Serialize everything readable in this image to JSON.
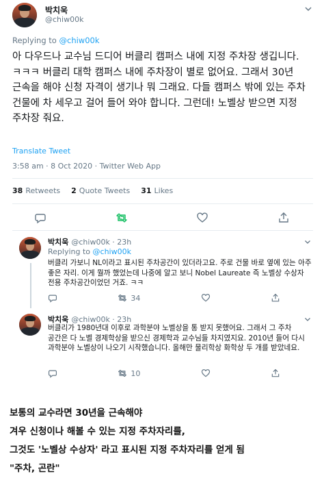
{
  "main_tweet": {
    "name": "박치욱",
    "handle": "@chiw00k",
    "replying_label": "Replying to",
    "replying_handle": "@chiw00k",
    "text": "아 다우드나 교수님 드디어 버클리 캠퍼스 내에 지정 주차장 생깁니다. ㅋㅋㅋ 버클리 대학 캠퍼스 내에 주차장이 별로 없어요. 그래서 30년 근속을 해야 신청 자격이 생기나 뭐 그래요. 다들 캠퍼스 밖에 있는 주차 건물에 차 세우고 걸어 들어 와야 합니다. 그런데! 노벨상 받으면 지정 주차장 줘요.",
    "translate_label": "Translate Tweet",
    "meta": "3:58 am · 8 Oct 2020 · Twitter Web App",
    "retweets_count": "38",
    "retweets_label": "Retweets",
    "quotes_count": "2",
    "quotes_label": "Quote Tweets",
    "likes_count": "31",
    "likes_label": "Likes"
  },
  "replies": [
    {
      "name": "박치욱",
      "handle": "@chiw00k · 23h",
      "replying_label": "Replying to",
      "replying_handle": "@chiw00k",
      "text": "버클리 가보니 NL이라고 표시된 주차공간이 있더라고요. 주로 건물 바로 옆에 있는 아주 좋은 자리. 이게 뭘까 했었는데 나중에 알고 보니 Nobel Laureate 즉 노벨상 수상자 전용 주차공간이었던 거죠. ㅋㅋ",
      "retweets": "34"
    },
    {
      "name": "박치욱",
      "handle": "@chiw00k · 23h",
      "text": "버클리가 1980년대 이후로 과학분야 노벨상을 통 받지 못했어요. 그래서 그 주차 공간은 다 노벨 경제학상을 받으신 경제학과 교수님들 차지였지요. 2010년 들어 다시 과학분야 노벨상이 나오기 시작했습니다. 올해만 물리학상 화학상 두 개를 받았네요.",
      "retweets": "10"
    }
  ],
  "caption": {
    "line1": "보통의 교수라면 30년을 근속해야",
    "line2": "겨우 신청이나 해볼 수 있는 지정 주차자리를,",
    "line3": "그것도 '노벨상 수상자' 라고 표시된 지정 주차자리를 얻게 됨",
    "line4": "\"주차, 곤란\""
  },
  "colors": {
    "accent": "#1da1f2",
    "retweet_green": "#17bf63",
    "muted": "#657786",
    "divider": "#e6ecf0"
  },
  "icons": [
    "reply-icon",
    "retweet-icon",
    "like-icon",
    "share-icon",
    "caret-down-icon"
  ]
}
